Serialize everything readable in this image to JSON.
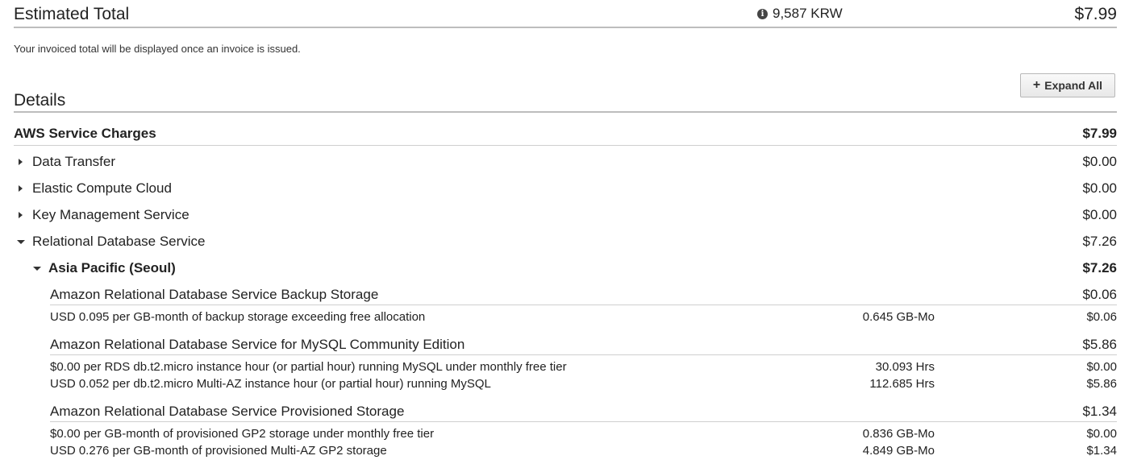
{
  "estimated": {
    "title": "Estimated Total",
    "krw": "9,587 KRW",
    "total": "$7.99",
    "note": "Your invoiced total will be displayed once an invoice is issued."
  },
  "details": {
    "title": "Details",
    "expand_all": "Expand All"
  },
  "service_charges": {
    "title": "AWS Service Charges",
    "amount": "$7.99",
    "services": [
      {
        "name": "Data Transfer",
        "amount": "$0.00"
      },
      {
        "name": "Elastic Compute Cloud",
        "amount": "$0.00"
      },
      {
        "name": "Key Management Service",
        "amount": "$0.00"
      },
      {
        "name": "Relational Database Service",
        "amount": "$7.26"
      }
    ]
  },
  "region": {
    "name": "Asia Pacific (Seoul)",
    "amount": "$7.26",
    "groups": [
      {
        "name": "Amazon Relational Database Service Backup Storage",
        "amount": "$0.06",
        "lines": [
          {
            "desc": "USD 0.095 per GB-month of backup storage exceeding free allocation",
            "usage": "0.645 GB-Mo",
            "amount": "$0.06"
          }
        ]
      },
      {
        "name": "Amazon Relational Database Service for MySQL Community Edition",
        "amount": "$5.86",
        "lines": [
          {
            "desc": "$0.00 per RDS db.t2.micro instance hour (or partial hour) running MySQL under monthly free tier",
            "usage": "30.093 Hrs",
            "amount": "$0.00"
          },
          {
            "desc": "USD 0.052 per db.t2.micro Multi-AZ instance hour (or partial hour) running MySQL",
            "usage": "112.685 Hrs",
            "amount": "$5.86"
          }
        ]
      },
      {
        "name": "Amazon Relational Database Service Provisioned Storage",
        "amount": "$1.34",
        "lines": [
          {
            "desc": "$0.00 per GB-month of provisioned GP2 storage under monthly free tier",
            "usage": "0.836 GB-Mo",
            "amount": "$0.00"
          },
          {
            "desc": "USD 0.276 per GB-month of provisioned Multi-AZ GP2 storage",
            "usage": "4.849 GB-Mo",
            "amount": "$1.34"
          }
        ]
      }
    ]
  }
}
